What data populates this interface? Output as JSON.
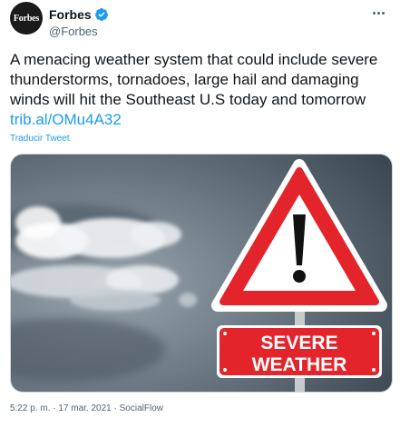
{
  "author": {
    "avatar_text": "Forbes",
    "display_name": "Forbes",
    "handle": "@Forbes",
    "verified": true,
    "verified_icon": "verified-badge-icon",
    "more_icon": "more-options-icon"
  },
  "tweet": {
    "text": "A menacing weather system that could include severe thunderstorms, tornadoes, large hail and damaging winds will hit the Southeast U.S today and tomorrow",
    "link": "trib.al/OMu4A32",
    "translate_label": "Traducir Tweet"
  },
  "media": {
    "sign_line1": "SEVERE",
    "sign_line2": "WEATHER",
    "sign_symbol": "!",
    "sign_red": "#e3252b",
    "sky_color": "#5f6c77"
  },
  "meta": {
    "time": "5:22 p. m.",
    "separator": " · ",
    "date": "17 mar. 2021",
    "source": "SocialFlow"
  },
  "colors": {
    "accent": "#1d9bf0",
    "text": "#0f1419",
    "muted": "#536471"
  }
}
